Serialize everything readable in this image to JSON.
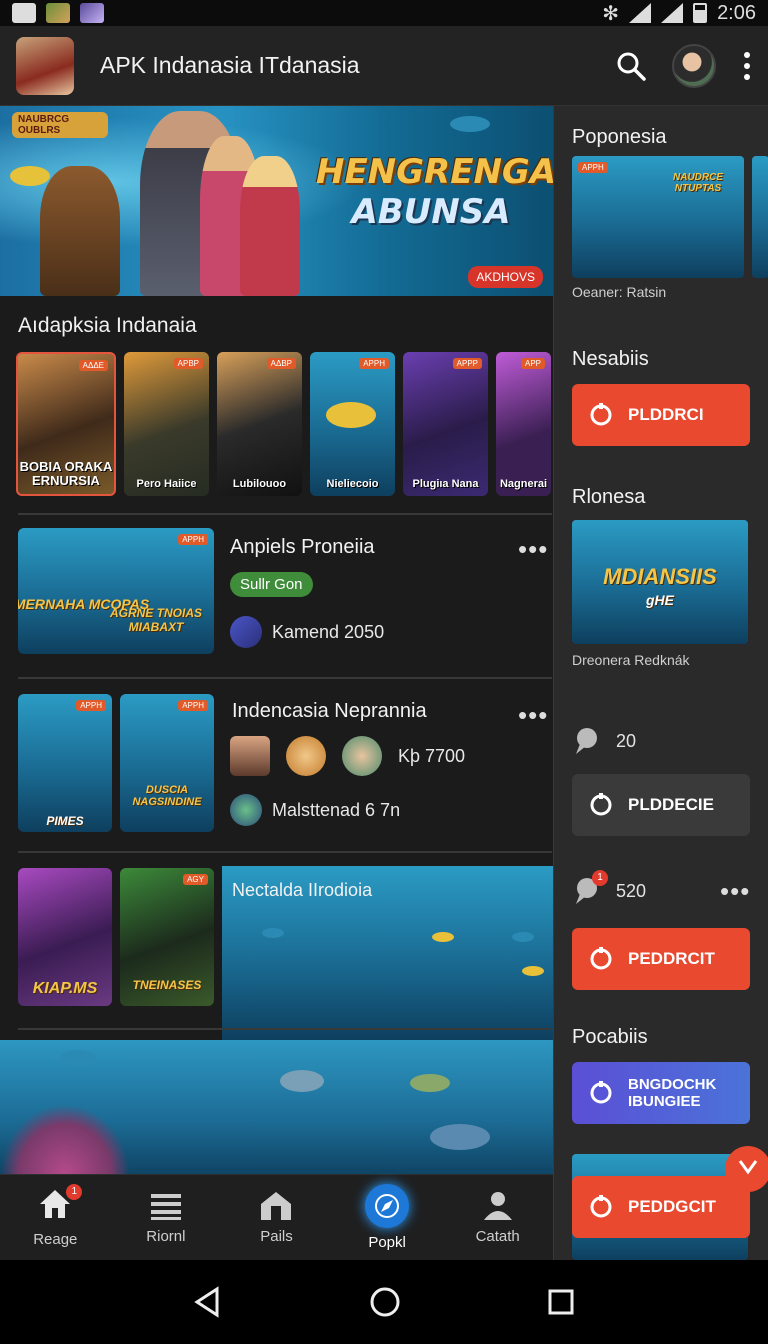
{
  "status_bar": {
    "time": "2:06"
  },
  "app_bar": {
    "title": "APK Indanasia ITdanasia"
  },
  "hero": {
    "title": "HENGRENGAINE",
    "subtitle": "ABUNSA",
    "logo_text": "NAUBRCG OUBLRS",
    "tag": "AKDHOVS"
  },
  "featured": {
    "title": "Aıdapksia Indanaia",
    "cards": [
      {
        "label": "BOBIA ORAKA ERNURSIA",
        "tag": "ΑΔΔΕ"
      },
      {
        "label": "Pero Haiice",
        "tag": "ΑΡΒΡ"
      },
      {
        "label": "Lubilouoo",
        "tag": "ΑΔΒΡ"
      },
      {
        "label": "Nieliecoio",
        "tag": "ΑΡΡΗ"
      },
      {
        "label": "Plugiıa Nana",
        "tag": "ΑΡΡΡ"
      },
      {
        "label": "Nagnerai",
        "tag": "ΑΡΡ"
      }
    ]
  },
  "rows": [
    {
      "title": "Anpiels Proneiia",
      "chip": "Sullr Gon",
      "meta": "Kamend 2050",
      "thumb_text": "COMERNAHA MCOPAS",
      "thumb_text2": "AGRNE TNOIAS MIABAXT",
      "thumb_tag": "ΑΡΡΗ"
    },
    {
      "title": "Indencasia Neprannia",
      "price": "Kþ 7700",
      "meta": "Malsttenad 6 7n",
      "thumb_label": "PIMES",
      "thumb_text2": "DUSCIA NAGSINDINE",
      "thumb_tag": "ΑΡΡΗ"
    },
    {
      "title": "Nectalda IIrodioia",
      "thumb_text": "KIAP.MS",
      "thumb_text2": "TNEINASES",
      "thumb_tag": "AGY"
    }
  ],
  "side": {
    "section1": {
      "title": "Poponesia",
      "caption": "Oeaner: Ratsin",
      "thumb_text": "NAUDRCE NTUPTAS",
      "thumb_tag": "ΑΡΡΗ"
    },
    "section2": {
      "title": "Nesabiis",
      "button": "PLDDRCI"
    },
    "section3": {
      "title": "Rlonesa",
      "caption": "Dreonera Redknák",
      "thumb_text": "MDIANSIIS",
      "thumb_sub": "gHE"
    },
    "stat1": {
      "value": "20"
    },
    "button2": "PLDDECIE",
    "stat2": {
      "value": "520",
      "badge": "1"
    },
    "button3": "PEDDRCIT",
    "section4": {
      "title": "Pocabiis",
      "button": "BNGDOCHK IBUNGIEE"
    },
    "button4": "PEDDGCIT"
  },
  "bottom_nav": {
    "items": [
      {
        "label": "Reage",
        "badge": "1"
      },
      {
        "label": "Riornl"
      },
      {
        "label": "Pails"
      },
      {
        "label": "Popkl"
      },
      {
        "label": "Catath"
      }
    ]
  },
  "colors": {
    "accent": "#e8492f",
    "background": "#1b1b1c",
    "active_nav": "#1d78d8",
    "chip_green": "#3f8d3a"
  }
}
